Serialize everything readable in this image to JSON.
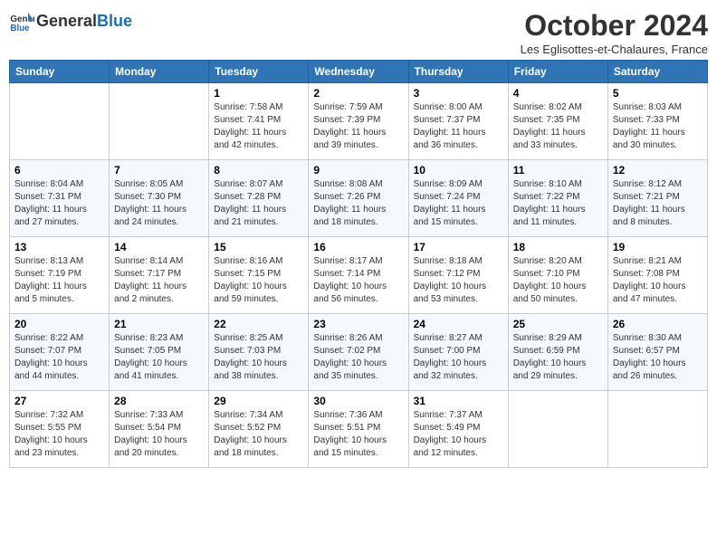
{
  "header": {
    "logo_text_general": "General",
    "logo_text_blue": "Blue",
    "month_title": "October 2024",
    "location": "Les Eglisottes-et-Chalaures, France"
  },
  "days_of_week": [
    "Sunday",
    "Monday",
    "Tuesday",
    "Wednesday",
    "Thursday",
    "Friday",
    "Saturday"
  ],
  "weeks": [
    [
      {
        "day": "",
        "info": ""
      },
      {
        "day": "",
        "info": ""
      },
      {
        "day": "1",
        "info": "Sunrise: 7:58 AM\nSunset: 7:41 PM\nDaylight: 11 hours and 42 minutes."
      },
      {
        "day": "2",
        "info": "Sunrise: 7:59 AM\nSunset: 7:39 PM\nDaylight: 11 hours and 39 minutes."
      },
      {
        "day": "3",
        "info": "Sunrise: 8:00 AM\nSunset: 7:37 PM\nDaylight: 11 hours and 36 minutes."
      },
      {
        "day": "4",
        "info": "Sunrise: 8:02 AM\nSunset: 7:35 PM\nDaylight: 11 hours and 33 minutes."
      },
      {
        "day": "5",
        "info": "Sunrise: 8:03 AM\nSunset: 7:33 PM\nDaylight: 11 hours and 30 minutes."
      }
    ],
    [
      {
        "day": "6",
        "info": "Sunrise: 8:04 AM\nSunset: 7:31 PM\nDaylight: 11 hours and 27 minutes."
      },
      {
        "day": "7",
        "info": "Sunrise: 8:05 AM\nSunset: 7:30 PM\nDaylight: 11 hours and 24 minutes."
      },
      {
        "day": "8",
        "info": "Sunrise: 8:07 AM\nSunset: 7:28 PM\nDaylight: 11 hours and 21 minutes."
      },
      {
        "day": "9",
        "info": "Sunrise: 8:08 AM\nSunset: 7:26 PM\nDaylight: 11 hours and 18 minutes."
      },
      {
        "day": "10",
        "info": "Sunrise: 8:09 AM\nSunset: 7:24 PM\nDaylight: 11 hours and 15 minutes."
      },
      {
        "day": "11",
        "info": "Sunrise: 8:10 AM\nSunset: 7:22 PM\nDaylight: 11 hours and 11 minutes."
      },
      {
        "day": "12",
        "info": "Sunrise: 8:12 AM\nSunset: 7:21 PM\nDaylight: 11 hours and 8 minutes."
      }
    ],
    [
      {
        "day": "13",
        "info": "Sunrise: 8:13 AM\nSunset: 7:19 PM\nDaylight: 11 hours and 5 minutes."
      },
      {
        "day": "14",
        "info": "Sunrise: 8:14 AM\nSunset: 7:17 PM\nDaylight: 11 hours and 2 minutes."
      },
      {
        "day": "15",
        "info": "Sunrise: 8:16 AM\nSunset: 7:15 PM\nDaylight: 10 hours and 59 minutes."
      },
      {
        "day": "16",
        "info": "Sunrise: 8:17 AM\nSunset: 7:14 PM\nDaylight: 10 hours and 56 minutes."
      },
      {
        "day": "17",
        "info": "Sunrise: 8:18 AM\nSunset: 7:12 PM\nDaylight: 10 hours and 53 minutes."
      },
      {
        "day": "18",
        "info": "Sunrise: 8:20 AM\nSunset: 7:10 PM\nDaylight: 10 hours and 50 minutes."
      },
      {
        "day": "19",
        "info": "Sunrise: 8:21 AM\nSunset: 7:08 PM\nDaylight: 10 hours and 47 minutes."
      }
    ],
    [
      {
        "day": "20",
        "info": "Sunrise: 8:22 AM\nSunset: 7:07 PM\nDaylight: 10 hours and 44 minutes."
      },
      {
        "day": "21",
        "info": "Sunrise: 8:23 AM\nSunset: 7:05 PM\nDaylight: 10 hours and 41 minutes."
      },
      {
        "day": "22",
        "info": "Sunrise: 8:25 AM\nSunset: 7:03 PM\nDaylight: 10 hours and 38 minutes."
      },
      {
        "day": "23",
        "info": "Sunrise: 8:26 AM\nSunset: 7:02 PM\nDaylight: 10 hours and 35 minutes."
      },
      {
        "day": "24",
        "info": "Sunrise: 8:27 AM\nSunset: 7:00 PM\nDaylight: 10 hours and 32 minutes."
      },
      {
        "day": "25",
        "info": "Sunrise: 8:29 AM\nSunset: 6:59 PM\nDaylight: 10 hours and 29 minutes."
      },
      {
        "day": "26",
        "info": "Sunrise: 8:30 AM\nSunset: 6:57 PM\nDaylight: 10 hours and 26 minutes."
      }
    ],
    [
      {
        "day": "27",
        "info": "Sunrise: 7:32 AM\nSunset: 5:55 PM\nDaylight: 10 hours and 23 minutes."
      },
      {
        "day": "28",
        "info": "Sunrise: 7:33 AM\nSunset: 5:54 PM\nDaylight: 10 hours and 20 minutes."
      },
      {
        "day": "29",
        "info": "Sunrise: 7:34 AM\nSunset: 5:52 PM\nDaylight: 10 hours and 18 minutes."
      },
      {
        "day": "30",
        "info": "Sunrise: 7:36 AM\nSunset: 5:51 PM\nDaylight: 10 hours and 15 minutes."
      },
      {
        "day": "31",
        "info": "Sunrise: 7:37 AM\nSunset: 5:49 PM\nDaylight: 10 hours and 12 minutes."
      },
      {
        "day": "",
        "info": ""
      },
      {
        "day": "",
        "info": ""
      }
    ]
  ]
}
